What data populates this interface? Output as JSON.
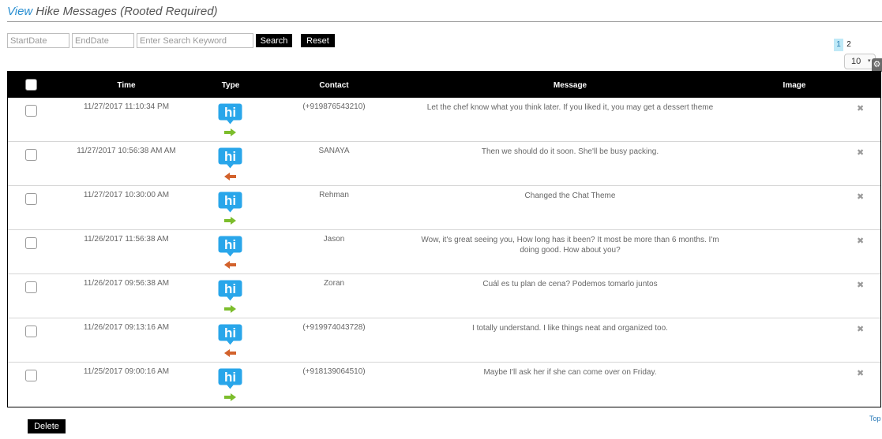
{
  "header": {
    "title_link": "View",
    "title_rest": "Hike Messages (Rooted Required)"
  },
  "filters": {
    "start_placeholder": "StartDate",
    "end_placeholder": "EndDate",
    "keyword_placeholder": "Enter Search Keyword",
    "search_label": "Search",
    "reset_label": "Reset"
  },
  "pagination": {
    "pages": [
      "1",
      "2"
    ],
    "current": "1",
    "page_size": "10"
  },
  "table": {
    "columns": {
      "time": "Time",
      "type": "Type",
      "contact": "Contact",
      "message": "Message",
      "image": "Image"
    },
    "rows": [
      {
        "time": "11/27/2017 11:10:34 PM",
        "direction": "outgoing",
        "contact": "(+919876543210)",
        "message": "Let the chef know what you think later. If you liked it, you may get a dessert theme"
      },
      {
        "time": "11/27/2017 10:56:38 AM AM",
        "direction": "incoming",
        "contact": "SANAYA",
        "message": "Then we should do it soon. She'll be busy packing."
      },
      {
        "time": "11/27/2017 10:30:00 AM",
        "direction": "outgoing",
        "contact": "Rehman",
        "message": "Changed the Chat Theme"
      },
      {
        "time": "11/26/2017 11:56:38 AM",
        "direction": "incoming",
        "contact": "Jason",
        "message": "Wow, it's great seeing you, How long has it been? It most be more than 6 months. I'm doing good. How about you?"
      },
      {
        "time": "11/26/2017 09:56:38 AM",
        "direction": "outgoing",
        "contact": "Zoran",
        "message": "Cuál es tu plan de cena? Podemos tomarlo juntos"
      },
      {
        "time": "11/26/2017 09:13:16 AM",
        "direction": "incoming",
        "contact": "(+919974043728)",
        "message": "I totally understand. I like things neat and organized too."
      },
      {
        "time": "11/25/2017 09:00:16 AM",
        "direction": "outgoing",
        "contact": "(+918139064510)",
        "message": "Maybe I'll ask her if she can come over on Friday."
      }
    ]
  },
  "icons": {
    "type": "hike-messenger-icon",
    "outgoing": "arrow-right-icon",
    "incoming": "arrow-left-icon",
    "delete_row": "close-icon",
    "settings": "gear-icon"
  },
  "colors": {
    "link": "#2a8fd1",
    "hike_blue": "#29a6ea",
    "outgoing_arrow": "#7cbd2c",
    "incoming_arrow": "#d2622c",
    "header_bg": "#000000"
  },
  "footer": {
    "delete_label": "Delete",
    "top_link": "Top"
  }
}
